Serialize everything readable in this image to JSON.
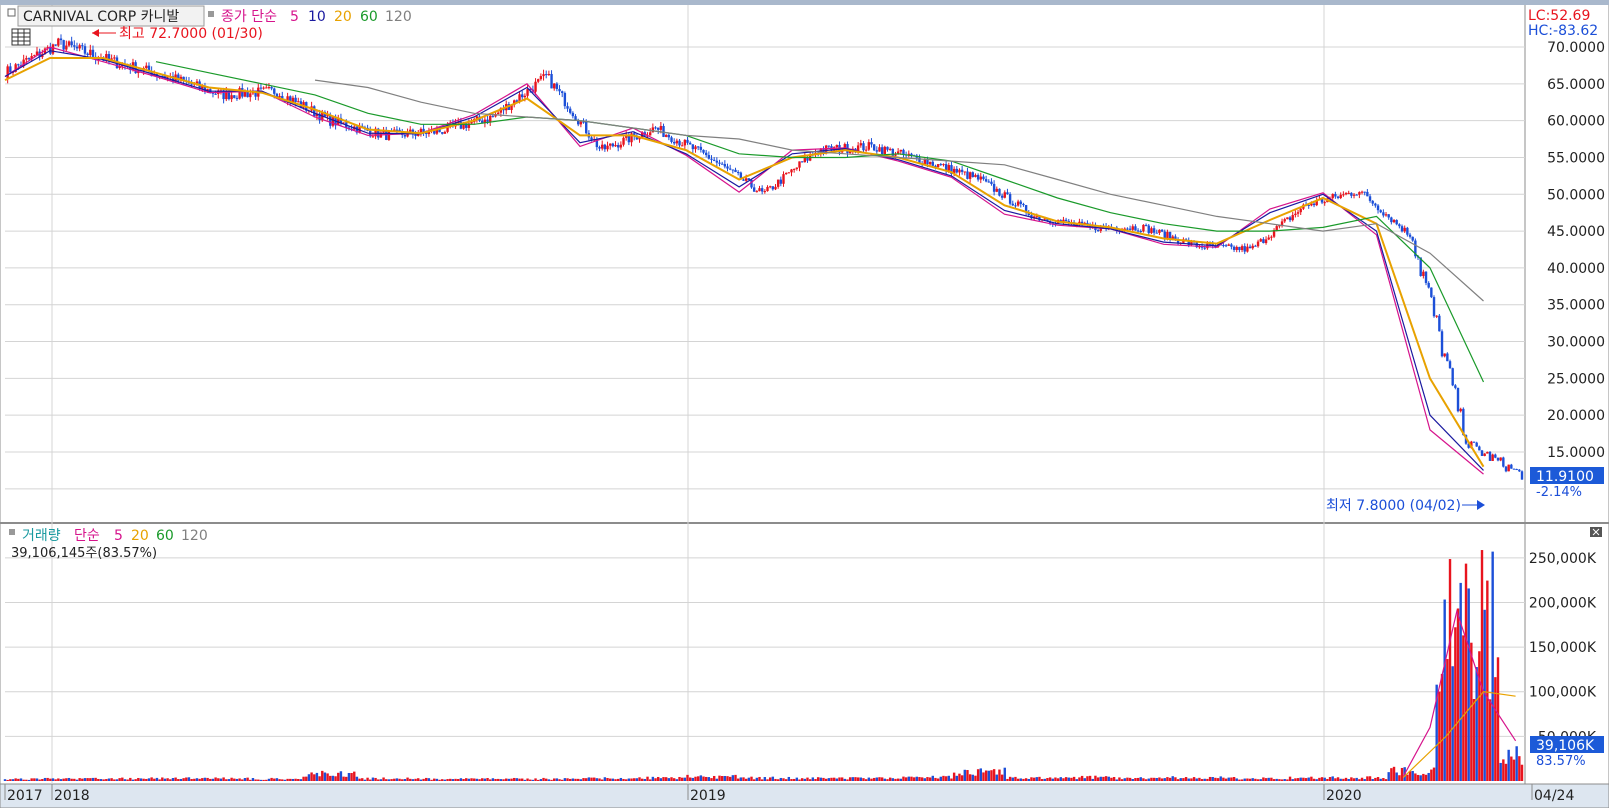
{
  "legend": {
    "title": "CARNIVAL CORP  카니발",
    "price_type": "종가 단순",
    "ma5": "5",
    "ma10": "10",
    "ma20": "20",
    "ma60": "60",
    "ma120": "120",
    "volume_label": "거래량",
    "volume_type": "단순",
    "volume_value": "39,106,145주(83.57%)"
  },
  "annotations": {
    "high": "최고 72.7000 (01/30)",
    "low": "최저 7.8000 (04/02)",
    "lc": "LC:52.69",
    "hc": "HC:-83.62",
    "last_price": "11.9100",
    "last_change": "-2.14%",
    "last_volume": "39,106K",
    "last_volume_pct": "83.57%"
  },
  "colors": {
    "up": "#e8141e",
    "down": "#1c4fd8",
    "ma5": "#d6148c",
    "ma10": "#1a1aa0",
    "ma20": "#e8a200",
    "ma60": "#1a9a2a",
    "ma120": "#808080",
    "grid": "#d4d4d4"
  },
  "chart_data": [
    {
      "type": "line",
      "title": "CARNIVAL CORP 카니발",
      "x_ticks": [
        "2017",
        "2018",
        "2019",
        "2020",
        "04/24"
      ],
      "y_ticks": [
        "70.0000",
        "65.0000",
        "60.0000",
        "55.0000",
        "50.0000",
        "45.0000",
        "40.0000",
        "35.0000",
        "30.0000",
        "25.0000",
        "20.0000",
        "15.0000"
      ],
      "ylim": [
        7.8,
        72.7
      ],
      "grid": true,
      "series": [
        {
          "name": "종가",
          "dates": [
            "2017-12",
            "2018-01",
            "2018-02",
            "2018-03",
            "2018-04",
            "2018-05",
            "2018-06",
            "2018-07",
            "2018-08",
            "2018-09",
            "2018-10",
            "2018-11",
            "2018-12",
            "2019-01",
            "2019-02",
            "2019-03",
            "2019-04",
            "2019-05",
            "2019-06",
            "2019-07",
            "2019-08",
            "2019-09",
            "2019-10",
            "2019-11",
            "2019-12",
            "2020-01",
            "2020-02",
            "2020-03",
            "2020-04"
          ],
          "values": [
            66.5,
            70.5,
            68,
            66,
            63.5,
            64,
            60,
            58,
            58.5,
            60.5,
            66,
            56,
            59,
            55,
            50,
            56,
            56.5,
            54.5,
            52,
            47,
            45.5,
            45.5,
            43,
            42.5,
            48.5,
            50.5,
            44,
            16,
            11.91
          ]
        },
        {
          "name": "5",
          "values": [
            66,
            70,
            68,
            66,
            63.8,
            64,
            60.5,
            58,
            58.3,
            60.8,
            65,
            56.5,
            59,
            55.3,
            50.3,
            56,
            56.3,
            54.5,
            52.3,
            47.3,
            45.8,
            45.3,
            43.2,
            42.8,
            48,
            50.2,
            44.5,
            18,
            12
          ]
        },
        {
          "name": "10",
          "values": [
            66,
            69.5,
            68.3,
            66.2,
            64,
            64,
            61,
            58.3,
            58.2,
            60.5,
            64.5,
            57,
            58.5,
            55.5,
            51,
            55.5,
            56.2,
            54.7,
            52.5,
            47.8,
            46,
            45.3,
            43.5,
            43,
            47.5,
            50,
            45,
            20,
            12.5
          ]
        },
        {
          "name": "20",
          "values": [
            65.5,
            68.5,
            68.5,
            66.5,
            64.5,
            63.8,
            61.5,
            58.8,
            58.3,
            60,
            63,
            58,
            58,
            56,
            52,
            55,
            56,
            55,
            53,
            48.5,
            46.3,
            45.5,
            44,
            43.3,
            46.5,
            49.5,
            46,
            25,
            13
          ]
        },
        {
          "name": "60",
          "values": [
            null,
            null,
            null,
            68,
            66.5,
            65,
            63.5,
            61,
            59.5,
            59.5,
            60.5,
            60,
            59,
            58,
            55.5,
            55,
            55,
            55.5,
            54.5,
            52,
            49.5,
            47.5,
            46,
            45,
            45,
            45.5,
            47,
            40,
            24.5
          ]
        },
        {
          "name": "120",
          "values": [
            null,
            null,
            null,
            null,
            null,
            null,
            65.5,
            64.5,
            62.5,
            61,
            60.5,
            60,
            59,
            58,
            57.5,
            56,
            55.5,
            55,
            54.5,
            54,
            52,
            50,
            48.5,
            47,
            46,
            45,
            46,
            42,
            35.5
          ]
        }
      ]
    },
    {
      "type": "bar",
      "title": "거래량",
      "x_ticks": [
        "2017",
        "2018",
        "2019",
        "2020",
        "04/24"
      ],
      "y_ticks": [
        "250,000K",
        "200,000K",
        "150,000K",
        "100,000K",
        "50,000K"
      ],
      "ylim": [
        0,
        270000
      ],
      "unit": "K",
      "series": [
        {
          "name": "거래량",
          "dates": [
            "2017-12",
            "2018-01",
            "2018-02",
            "2018-03",
            "2018-04",
            "2018-05",
            "2018-06",
            "2018-07",
            "2018-08",
            "2018-09",
            "2018-10",
            "2018-11",
            "2018-12",
            "2019-01",
            "2019-02",
            "2019-03",
            "2019-04",
            "2019-05",
            "2019-06",
            "2019-07",
            "2019-08",
            "2019-09",
            "2019-10",
            "2019-11",
            "2019-12",
            "2020-01",
            "2020-02",
            "2020-03",
            "2020-04"
          ],
          "values": [
            3000,
            3500,
            4000,
            4500,
            4000,
            3500,
            12000,
            4000,
            3500,
            3500,
            3500,
            4500,
            5000,
            7000,
            5000,
            4500,
            4500,
            6000,
            16000,
            5000,
            6000,
            4500,
            5500,
            4500,
            5000,
            5500,
            16000,
            260000,
            39106
          ]
        }
      ]
    }
  ]
}
